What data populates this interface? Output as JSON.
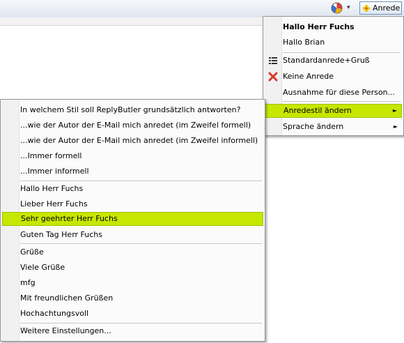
{
  "toolbar": {
    "pie_icon": "pie-chart-icon",
    "dropdown_arrow": "▾",
    "anrede_button": "Anrede",
    "anrede_icon": "flower-icon"
  },
  "colors": {
    "highlight": "#c6e700",
    "menu_background": "#f1f1f1"
  },
  "main_menu": {
    "items": [
      {
        "label": "Hallo Herr Fuchs",
        "bold": true
      },
      {
        "label": "Hallo Brian"
      },
      {
        "label": "Standardanrede+Gruß",
        "icon": "list-icon"
      },
      {
        "label": "Keine Anrede",
        "icon": "red-x-icon"
      },
      {
        "label": "Ausnahme für diese Person..."
      },
      {
        "label": "Anredestil ändern",
        "submenu": true,
        "highlighted": true
      },
      {
        "label": "Sprache ändern",
        "submenu": true
      }
    ],
    "submenu_arrow": "►"
  },
  "style_menu": {
    "items": [
      {
        "label": "In welchem Stil soll ReplyButler grundsätzlich antworten?"
      },
      {
        "label": "...wie der Autor der E-Mail mich anredet (im Zweifel formell)"
      },
      {
        "label": "...wie der Autor der E-Mail mich anredet (im Zweifel informell)"
      },
      {
        "label": "...Immer formell"
      },
      {
        "label": "...Immer informell"
      },
      {
        "label": "Hallo Herr Fuchs"
      },
      {
        "label": "Lieber Herr Fuchs"
      },
      {
        "label": "Sehr geehrter Herr Fuchs",
        "highlighted": true
      },
      {
        "label": "Guten Tag Herr Fuchs"
      },
      {
        "label": "Grüße"
      },
      {
        "label": "Viele Grüße"
      },
      {
        "label": "mfg"
      },
      {
        "label": "Mit freundlichen Grüßen"
      },
      {
        "label": "Hochachtungsvoll"
      },
      {
        "label": "Weitere Einstellungen..."
      }
    ]
  }
}
